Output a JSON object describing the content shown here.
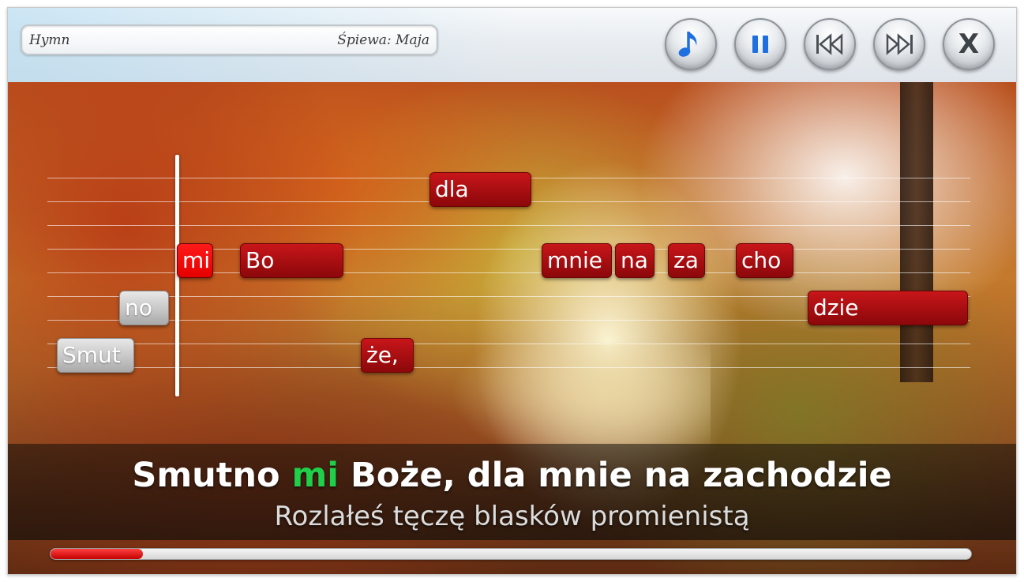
{
  "header": {
    "song_title": "Hymn",
    "singer": "Śpiewa: Maja"
  },
  "controls": [
    {
      "name": "music-note-button",
      "icon": "music-note-icon"
    },
    {
      "name": "pause-button",
      "icon": "pause-icon"
    },
    {
      "name": "previous-button",
      "icon": "skip-back-icon"
    },
    {
      "name": "next-button",
      "icon": "skip-forward-icon"
    },
    {
      "name": "close-button",
      "icon": "close-icon",
      "label": "X"
    }
  ],
  "notes": [
    {
      "text": "dla",
      "state": "upcoming"
    },
    {
      "text": "mi",
      "state": "active"
    },
    {
      "text": "Bo",
      "state": "upcoming"
    },
    {
      "text": "mnie",
      "state": "upcoming"
    },
    {
      "text": "na",
      "state": "upcoming"
    },
    {
      "text": "za",
      "state": "upcoming"
    },
    {
      "text": "cho",
      "state": "upcoming"
    },
    {
      "text": "no",
      "state": "sung"
    },
    {
      "text": "dzie",
      "state": "upcoming"
    },
    {
      "text": "Smut",
      "state": "sung"
    },
    {
      "text": "że,",
      "state": "upcoming"
    }
  ],
  "lyrics": {
    "current_before": "Smutno ",
    "current_highlight": "mi",
    "current_after": " Boże, dla mnie na zachodzie",
    "next_line": "Rozlałeś tęczę blasków promienistą"
  },
  "progress": {
    "fraction": 0.01
  },
  "colors": {
    "note_upcoming": "#a30d10",
    "note_active": "#ff0000",
    "note_sung": "#c4c4c4",
    "highlight_syllable": "#1fcf4a",
    "icon_blue": "#1f6fe0"
  }
}
